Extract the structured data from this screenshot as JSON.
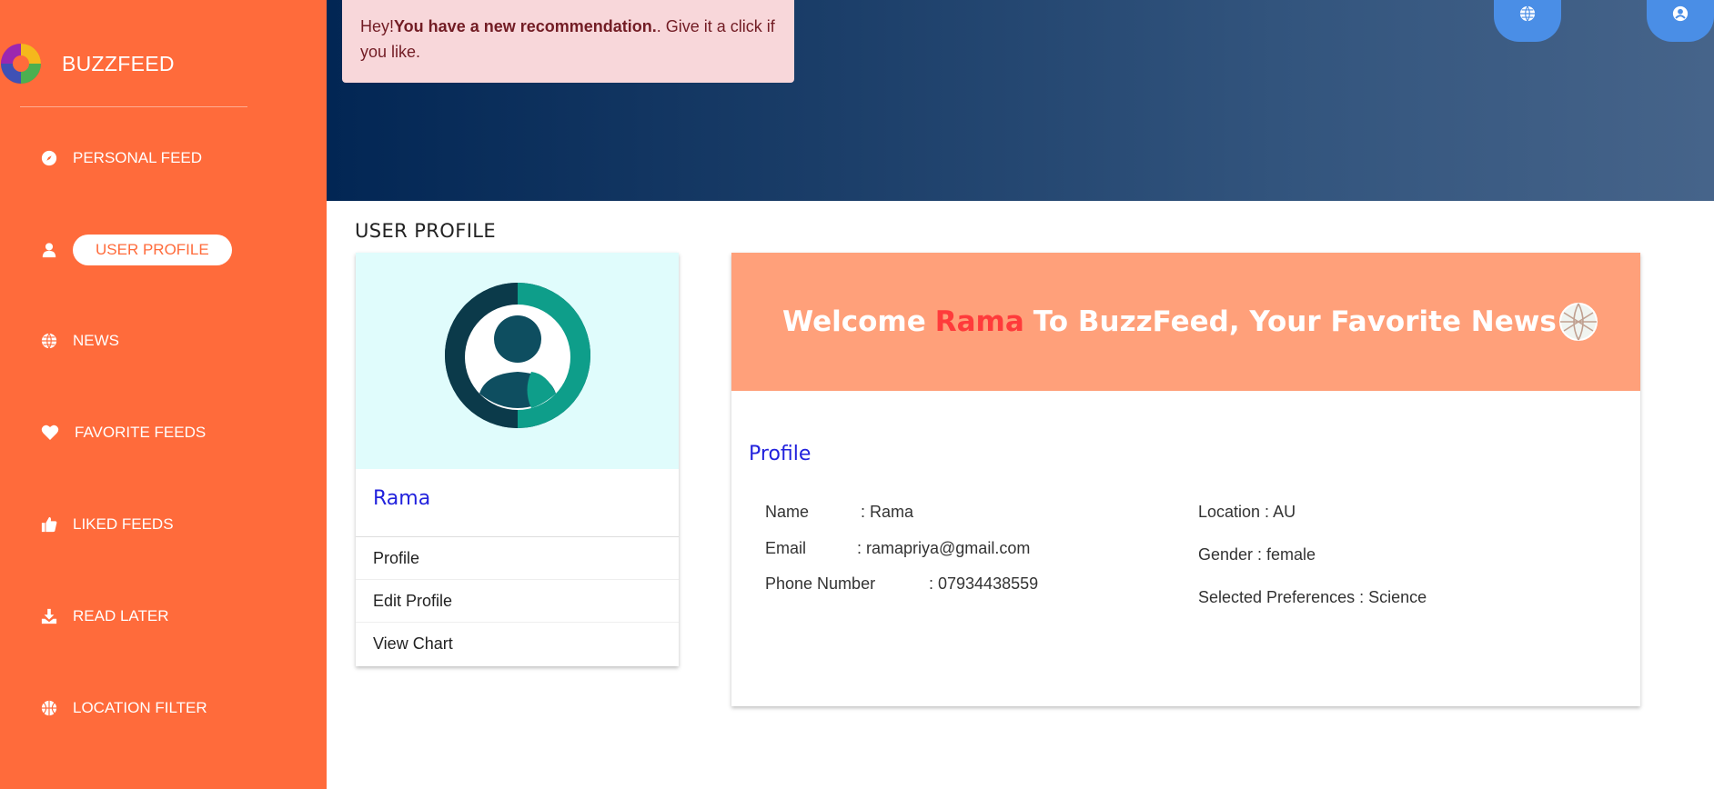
{
  "brand": {
    "name": "BUZZFEED",
    "logo": "pinwheel-logo"
  },
  "sidebar": {
    "items": [
      {
        "label": "PERSONAL FEED",
        "icon": "compass-icon"
      },
      {
        "label": "USER PROFILE",
        "icon": "user-icon",
        "active": true
      },
      {
        "label": "NEWS",
        "icon": "globe-icon"
      },
      {
        "label": "FAVORITE FEEDS",
        "icon": "heart-icon"
      },
      {
        "label": "LIKED FEEDS",
        "icon": "thumbs-up-icon"
      },
      {
        "label": "READ LATER",
        "icon": "download-icon"
      },
      {
        "label": "LOCATION FILTER",
        "icon": "basketball-icon"
      }
    ]
  },
  "alert": {
    "prefix": "Hey!",
    "bold": "You have a new recommendation.",
    "suffix": ". Give it a click if you like."
  },
  "header": {
    "buttons": [
      "globe-icon",
      "user-circle-icon"
    ]
  },
  "page": {
    "title": "USER PROFILE"
  },
  "profile_card": {
    "name": "Rama",
    "links": [
      "Profile",
      "Edit Profile",
      "View Chart"
    ]
  },
  "welcome": {
    "before": "Welcome",
    "name": "Rama",
    "after": "To BuzzFeed, Your Favorite News"
  },
  "profile": {
    "heading": "Profile",
    "name_label": "Name",
    "name_value": ": Rama",
    "email_label": "Email",
    "email_value": ": ramapriya@gmail.com",
    "phone_label": "Phone Number",
    "phone_value": ": 07934438559",
    "location": "Location : AU",
    "gender": "Gender : female",
    "preferences": "Selected Preferences : Science"
  },
  "colors": {
    "sidebar": "#ff6b3b",
    "header_start": "#022654",
    "header_end": "#46648a",
    "alert_bg": "#f8d7da",
    "welcome_bg": "#ffa07a",
    "highlight": "#ff3b3b",
    "link_blue": "#2222dd",
    "avatar_bg": "#e0fcfc"
  }
}
